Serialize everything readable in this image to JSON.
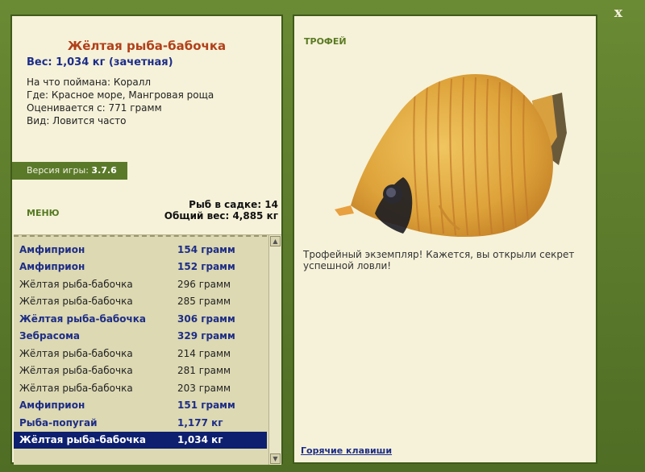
{
  "window": {
    "close_label": "x"
  },
  "fish": {
    "name": "Жёлтая рыба-бабочка",
    "weight": "Вес: 1,034 кг (зачетная)",
    "bait": "На что поймана: Коралл",
    "place": "Где: Красное море, Мангровая роща",
    "value": "Оценивается с: 771 грамм",
    "kind": "Вид: Ловится часто"
  },
  "version": {
    "label": "Версия игры:",
    "value": "3.7.6"
  },
  "menu_label": "МЕНЮ",
  "stats": {
    "in_keepnet": "Рыб в садке: 14",
    "total_weight": "Общий вес: 4,885 кг"
  },
  "catch_list": [
    {
      "name": "Амфиприон",
      "weight": "154 грамм",
      "style": "bold"
    },
    {
      "name": "Амфиприон",
      "weight": "152 грамм",
      "style": "bold"
    },
    {
      "name": "Жёлтая рыба-бабочка",
      "weight": "296 грамм",
      "style": "normal"
    },
    {
      "name": "Жёлтая рыба-бабочка",
      "weight": "285 грамм",
      "style": "normal"
    },
    {
      "name": "Жёлтая рыба-бабочка",
      "weight": "306 грамм",
      "style": "bold"
    },
    {
      "name": "Зебрасома",
      "weight": "329 грамм",
      "style": "bold"
    },
    {
      "name": "Жёлтая рыба-бабочка",
      "weight": "214 грамм",
      "style": "normal"
    },
    {
      "name": "Жёлтая рыба-бабочка",
      "weight": "281 грамм",
      "style": "normal"
    },
    {
      "name": "Жёлтая рыба-бабочка",
      "weight": "203 грамм",
      "style": "normal"
    },
    {
      "name": "Амфиприон",
      "weight": "151 грамм",
      "style": "bold"
    },
    {
      "name": "Рыба-попугай",
      "weight": "1,177 кг",
      "style": "bold"
    },
    {
      "name": "Жёлтая рыба-бабочка",
      "weight": "1,034 кг",
      "style": "selected"
    }
  ],
  "trophy_label": "ТРОФЕЙ",
  "trophy_message": "Трофейный экземпляр! Кажется, вы открыли секрет успешной ловли!",
  "hotkeys_label": "Горячие клавиши",
  "colors": {
    "frame": "#5b7a2c",
    "panel": "#f6f2d9",
    "title": "#b1401a",
    "accent_blue": "#1e2d86",
    "selection": "#0d1f6e",
    "fish": "#e0a838"
  },
  "fish_image": "yellow-butterflyfish"
}
